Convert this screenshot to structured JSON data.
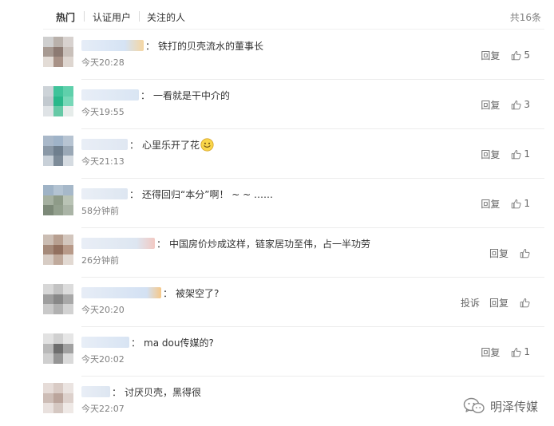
{
  "tabs": [
    {
      "label": "热门",
      "active": true
    },
    {
      "label": "认证用户",
      "active": false
    },
    {
      "label": "关注的人",
      "active": false
    }
  ],
  "total": "共16条",
  "comments": [
    {
      "text": "铁打的贝壳流水的董事长",
      "time": "今天20:28",
      "reply": "回复",
      "likes": "5"
    },
    {
      "text": "一看就是干中介的",
      "time": "今天19:55",
      "reply": "回复",
      "likes": "3"
    },
    {
      "text": "心里乐开了花",
      "time": "今天21:13",
      "reply": "回复",
      "likes": "1",
      "emoji": "smile-emoji"
    },
    {
      "text": "还得回归“本分”啊！ ~ ~ ……",
      "time": "58分钟前",
      "reply": "回复",
      "likes": "1"
    },
    {
      "text": "中国房价炒成这样，链家居功至伟，占一半功劳",
      "time": "26分钟前",
      "reply": "回复",
      "likes": ""
    },
    {
      "text": "被架空了?",
      "time": "今天20:20",
      "report": "投诉",
      "reply": "回复",
      "likes": ""
    },
    {
      "text": "ma dou传媒的?",
      "time": "今天20:02",
      "reply": "回复",
      "likes": "1"
    },
    {
      "text": "讨厌贝壳，黑得很",
      "time": "今天22:07",
      "reply": "",
      "likes": ""
    }
  ],
  "watermark": {
    "text": "明泽传媒",
    "icon": "wechat-icon"
  },
  "colors": {
    "accent": "#333333",
    "muted": "#808080",
    "divider": "#ececec"
  }
}
